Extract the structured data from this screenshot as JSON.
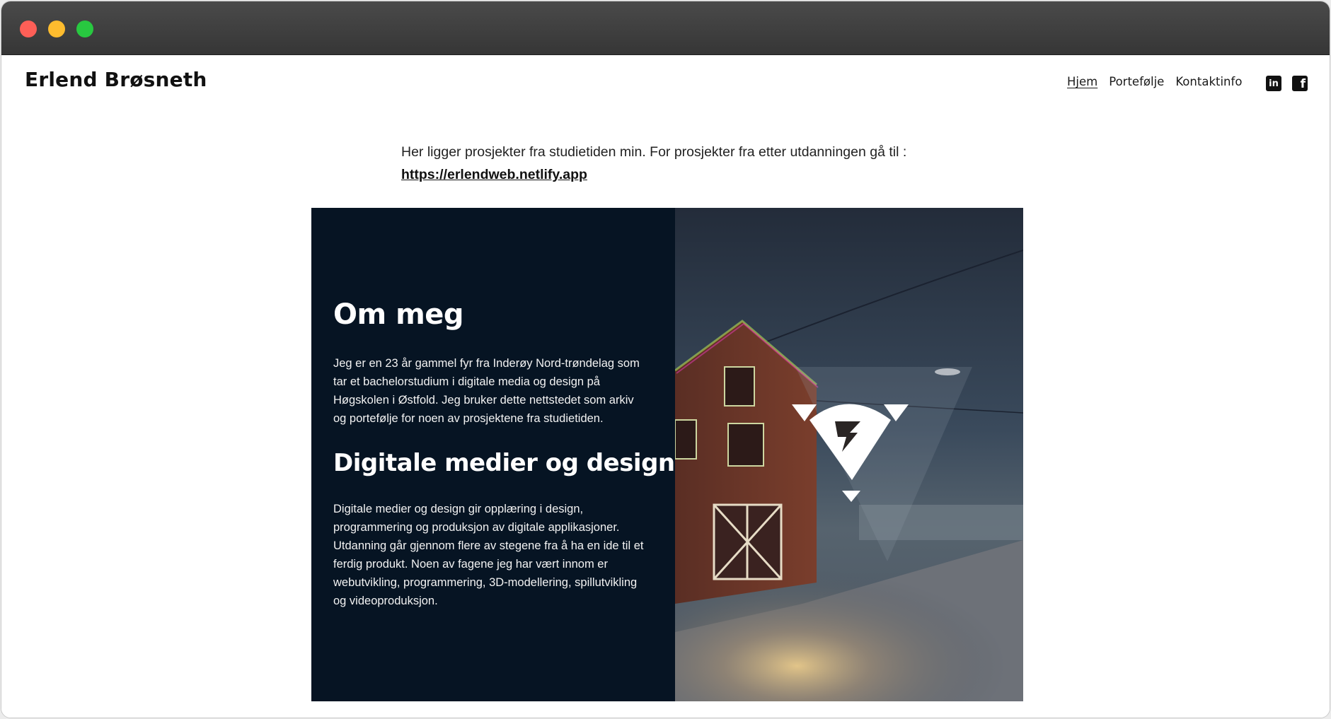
{
  "site": {
    "title": "Erlend Brøsneth"
  },
  "nav": {
    "items": [
      {
        "label": "Hjem",
        "active": true
      },
      {
        "label": "Portefølje",
        "active": false
      },
      {
        "label": "Kontaktinfo",
        "active": false
      }
    ]
  },
  "social": {
    "icons": [
      "linkedin-icon",
      "facebook-icon"
    ]
  },
  "intro": {
    "text": "Her ligger prosjekter fra studietiden min. For prosjekter fra etter utdanningen gå til :",
    "link": "https://erlendweb.netlify.app"
  },
  "about": {
    "heading": "Om meg",
    "text": "Jeg er en 23 år gammel fyr fra Inderøy Nord-trøndelag som tar et bachelorstudium i digitale media og design på Høgskolen i Østfold. Jeg bruker dette nettstedet som arkiv og portefølje for noen av prosjektene fra studietiden."
  },
  "program": {
    "heading": "Digitale medier og design",
    "text": "Digitale medier og design gir opplæring i design, programmering og produksjon av digitale applikasjoner. Utdanning går gjennom flere av stegene fra å ha en ide til et ferdig produkt. Noen av fagene jeg har vært innom er webutvikling, programmering, 3D-modellering, spillutvikling og videoproduksjon."
  },
  "colors": {
    "panel_bg": "#061423",
    "titlebar": "#3c3c3c"
  }
}
